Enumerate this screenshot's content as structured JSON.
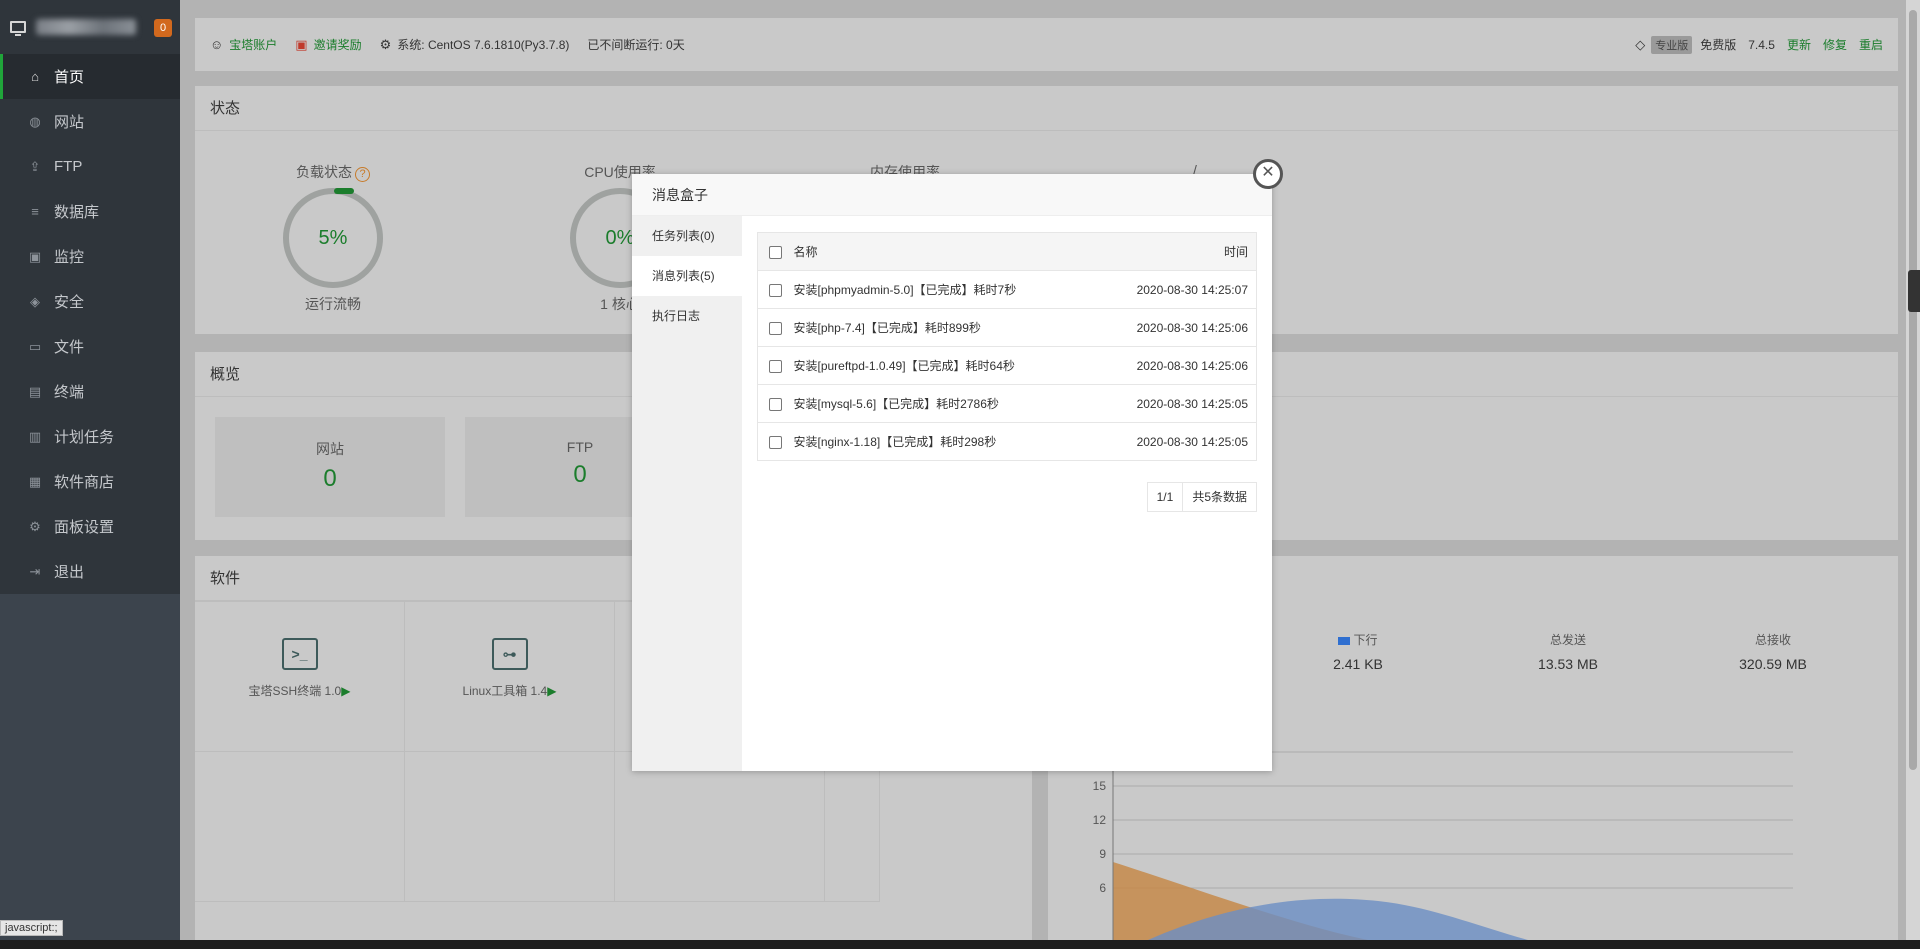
{
  "sidebar": {
    "badge": "0",
    "items": [
      {
        "label": "首页",
        "icon": "home-icon",
        "glyph": "⌂"
      },
      {
        "label": "网站",
        "icon": "globe-icon",
        "glyph": "◍"
      },
      {
        "label": "FTP",
        "icon": "ftp-icon",
        "glyph": "⇪"
      },
      {
        "label": "数据库",
        "icon": "database-icon",
        "glyph": "≡"
      },
      {
        "label": "监控",
        "icon": "monitor-icon",
        "glyph": "▣"
      },
      {
        "label": "安全",
        "icon": "shield-icon",
        "glyph": "◈"
      },
      {
        "label": "文件",
        "icon": "folder-icon",
        "glyph": "▭"
      },
      {
        "label": "终端",
        "icon": "terminal-icon",
        "glyph": "▤"
      },
      {
        "label": "计划任务",
        "icon": "calendar-icon",
        "glyph": "▥"
      },
      {
        "label": "软件商店",
        "icon": "grid-icon",
        "glyph": "▦"
      },
      {
        "label": "面板设置",
        "icon": "gear-icon",
        "glyph": "⚙"
      },
      {
        "label": "退出",
        "icon": "logout-icon",
        "glyph": "⇥"
      }
    ]
  },
  "topbar": {
    "account": "宝塔账户",
    "invite": "邀请奖励",
    "system_label": "系统:",
    "system_value": "CentOS 7.6.1810(Py3.7.8)",
    "uptime": "已不间断运行: 0天",
    "edition_badge": "专业版",
    "edition": "免费版",
    "version": "7.4.5",
    "update": "更新",
    "repair": "修复",
    "restart": "重启"
  },
  "status": {
    "title": "状态",
    "load_label": "负载状态",
    "load_value": "5%",
    "load_sub": "运行流畅",
    "cpu_label": "CPU使用率",
    "cpu_value": "0%",
    "cpu_sub": "1 核心",
    "mem_label": "内存使用率",
    "disk_label": "/"
  },
  "overview": {
    "title": "概览",
    "site_label": "网站",
    "site_value": "0",
    "ftp_label": "FTP",
    "ftp_value": "0"
  },
  "software": {
    "title": "软件",
    "items": [
      {
        "name": "宝塔SSH终端 1.0",
        "icon": "terminal-app-icon"
      },
      {
        "name": "Linux工具箱 1.4",
        "icon": "toolbox-icon"
      }
    ]
  },
  "traffic": {
    "down_label": "下行",
    "down_value": "2.41 KB",
    "sent_label": "总发送",
    "sent_value": "13.53 MB",
    "recv_label": "总接收",
    "recv_value": "320.59 MB",
    "y_ticks": [
      "15",
      "12",
      "9",
      "6"
    ],
    "down_color": "#2f6fd0",
    "up_color": "#d08a3a"
  },
  "modal": {
    "title": "消息盒子",
    "tabs": [
      "任务列表(0)",
      "消息列表(5)",
      "执行日志"
    ],
    "col_name": "名称",
    "col_time": "时间",
    "rows": [
      {
        "name": "安装[phpmyadmin-5.0]【已完成】耗时7秒",
        "time": "2020-08-30 14:25:07"
      },
      {
        "name": "安装[php-7.4]【已完成】耗时899秒",
        "time": "2020-08-30 14:25:06"
      },
      {
        "name": "安装[pureftpd-1.0.49]【已完成】耗时64秒",
        "time": "2020-08-30 14:25:06"
      },
      {
        "name": "安装[mysql-5.6]【已完成】耗时2786秒",
        "time": "2020-08-30 14:25:05"
      },
      {
        "name": "安装[nginx-1.18]【已完成】耗时298秒",
        "time": "2020-08-30 14:25:05"
      }
    ],
    "page": "1/1",
    "total": "共5条数据"
  },
  "status_tip": "javascript:;"
}
